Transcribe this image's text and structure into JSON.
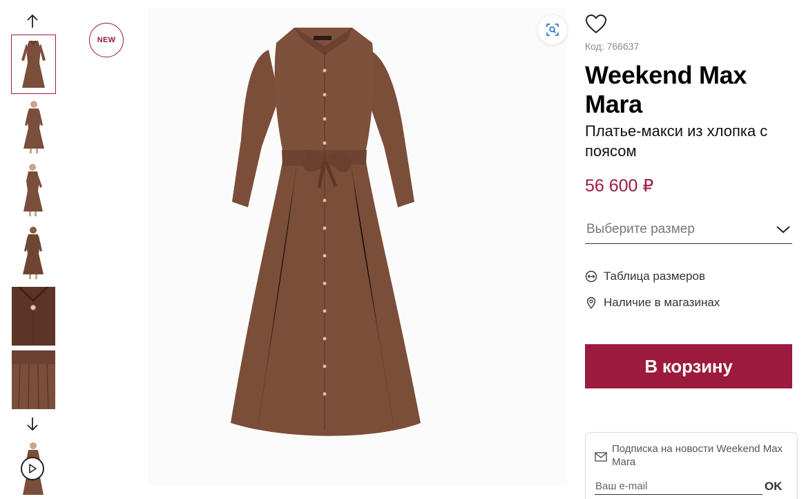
{
  "gallery": {
    "badge": "NEW",
    "up_icon": "arrow-up-icon",
    "down_icon": "arrow-down-icon",
    "zoom_icon": "zoom-scan-icon",
    "play_icon": "play-icon"
  },
  "product": {
    "code_label": "Код: 766637",
    "brand": "Weekend Max Mara",
    "name": "Платье-макси из хлопка с поясом",
    "price": "56 600 ₽",
    "size_placeholder": "Выберите размер"
  },
  "links": {
    "size_table": "Таблица размеров",
    "availability": "Наличие в магазинах"
  },
  "cart": {
    "label": "В корзину"
  },
  "subscribe": {
    "text": "Подписка на новости Weekend Max Mara",
    "email_placeholder": "Ваш e-mail",
    "ok_label": "OK"
  },
  "colors": {
    "accent": "#9b1a3d",
    "dress": "#7a4e3a"
  }
}
